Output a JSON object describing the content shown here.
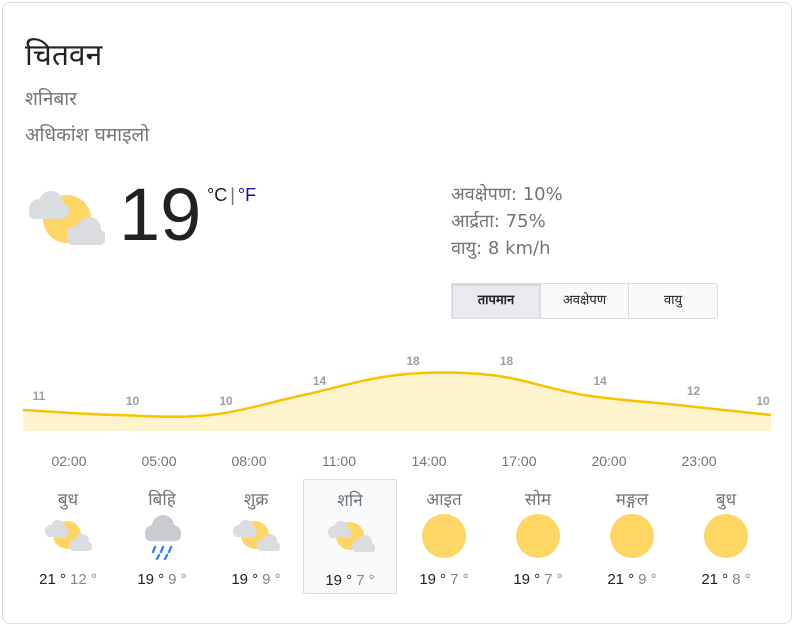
{
  "location": "चितवन",
  "day": "शनिबार",
  "condition": "अधिकांश घमाइलो",
  "current": {
    "temperature": "19",
    "unit_c": "°C",
    "separator": "|",
    "unit_f": "°F",
    "icon": "partly-cloudy-icon"
  },
  "details": {
    "precipitation": "अवक्षेपण: 10%",
    "humidity": "आर्द्रता: 75%",
    "wind": "वायु: 8 km/h"
  },
  "tabs": [
    {
      "label": "तापमान",
      "active": true
    },
    {
      "label": "अवक्षेपण",
      "active": false
    },
    {
      "label": "वायु",
      "active": false
    }
  ],
  "colors": {
    "line": "#f5c400",
    "fill": "#fdf4cd",
    "sun": "#fdd663",
    "cloud": "#dadce0",
    "link": "#1a0dab"
  },
  "chart_data": {
    "type": "area",
    "x": [
      "02:00",
      "05:00",
      "08:00",
      "11:00",
      "14:00",
      "17:00",
      "20:00",
      "23:00"
    ],
    "label_points": [
      {
        "value": 11
      },
      {
        "value": 10
      },
      {
        "value": 10
      },
      {
        "value": 14
      },
      {
        "value": 18
      },
      {
        "value": 18
      },
      {
        "value": 14
      },
      {
        "value": 12
      },
      {
        "value": 10
      }
    ],
    "hour_labels": [
      "02:00",
      "05:00",
      "08:00",
      "11:00",
      "14:00",
      "17:00",
      "20:00",
      "23:00"
    ]
  },
  "forecast": [
    {
      "day": "बुध",
      "high": "21 °",
      "low": "12 °",
      "icon": "partly-cloudy-icon"
    },
    {
      "day": "बिहि",
      "high": "19 °",
      "low": "9 °",
      "icon": "rain-icon"
    },
    {
      "day": "शुक्र",
      "high": "19 °",
      "low": "9 °",
      "icon": "partly-cloudy-icon"
    },
    {
      "day": "शनि",
      "high": "19 °",
      "low": "7 °",
      "icon": "partly-cloudy-icon",
      "selected": true
    },
    {
      "day": "आइत",
      "high": "19 °",
      "low": "7 °",
      "icon": "sunny-icon"
    },
    {
      "day": "सोम",
      "high": "19 °",
      "low": "7 °",
      "icon": "sunny-icon"
    },
    {
      "day": "मङ्गल",
      "high": "21 °",
      "low": "9 °",
      "icon": "sunny-icon"
    },
    {
      "day": "बुध",
      "high": "21 °",
      "low": "8 °",
      "icon": "sunny-icon"
    }
  ]
}
